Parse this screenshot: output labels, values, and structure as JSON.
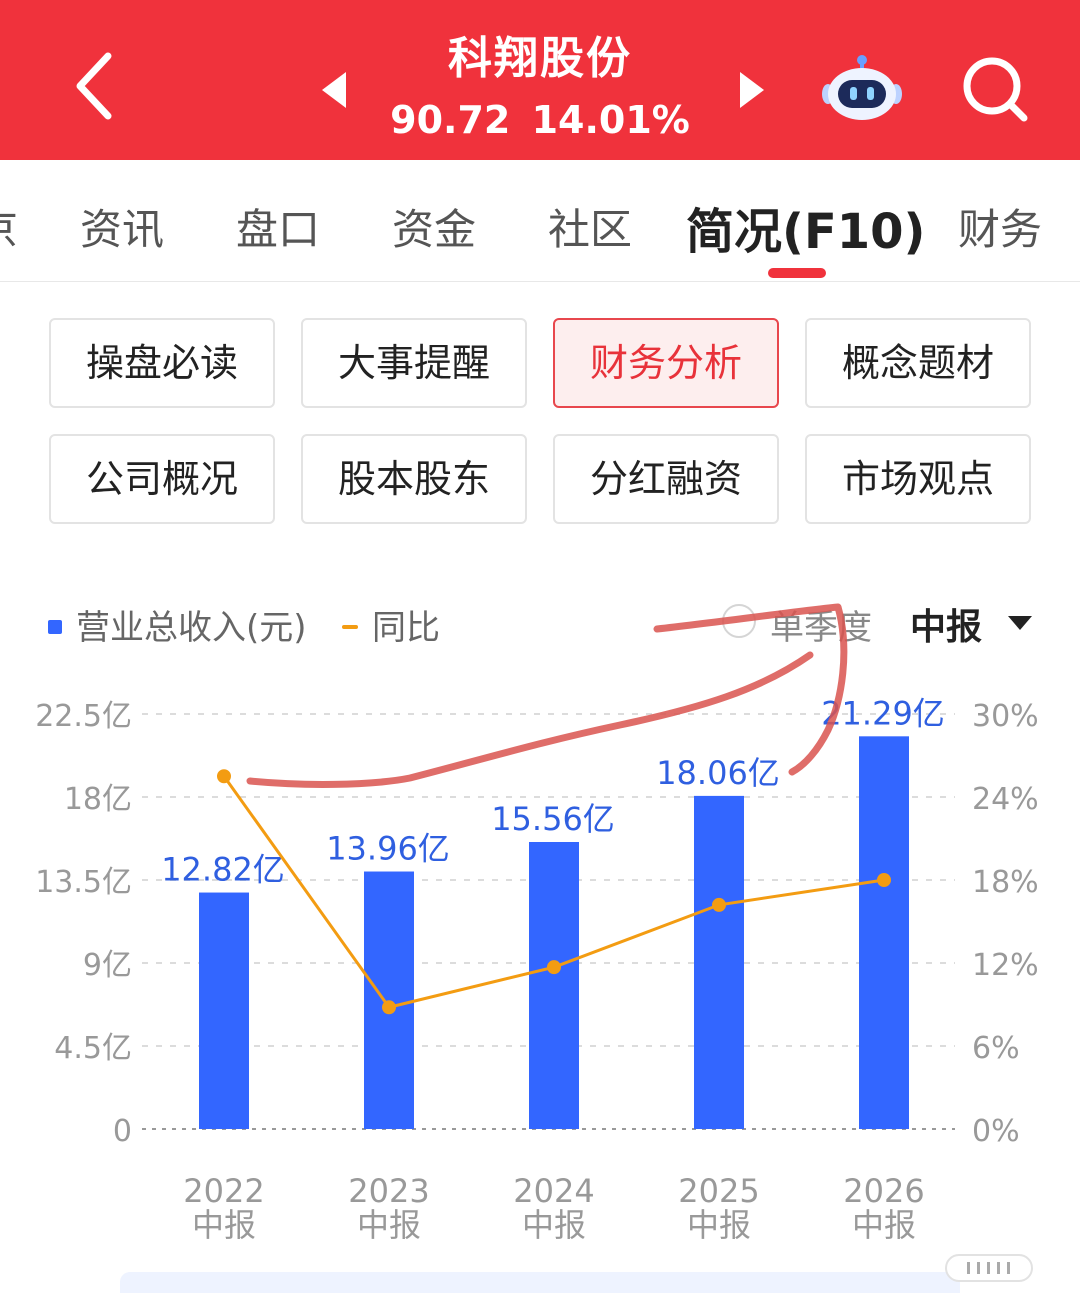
{
  "header": {
    "title": "科翔股份",
    "price": "90.72",
    "change_pct": "14.01%",
    "colors": {
      "brand": "#f0323c"
    }
  },
  "tabs": [
    {
      "label": "京",
      "active": false
    },
    {
      "label": "资讯",
      "active": false
    },
    {
      "label": "盘口",
      "active": false
    },
    {
      "label": "资金",
      "active": false
    },
    {
      "label": "社区",
      "active": false
    },
    {
      "label": "简况(F10)",
      "active": true
    },
    {
      "label": "财务",
      "active": false
    }
  ],
  "sub_buttons": [
    {
      "label": "操盘必读",
      "active": false
    },
    {
      "label": "大事提醒",
      "active": false
    },
    {
      "label": "财务分析",
      "active": true
    },
    {
      "label": "概念题材",
      "active": false
    },
    {
      "label": "公司概况",
      "active": false
    },
    {
      "label": "股本股东",
      "active": false
    },
    {
      "label": "分红融资",
      "active": false
    },
    {
      "label": "市场观点",
      "active": false
    }
  ],
  "legend": {
    "bar_label": "营业总收入(元)",
    "line_label": "同比"
  },
  "controls": {
    "single_quarter": "单季度",
    "period": "中报"
  },
  "chart_data": {
    "type": "bar",
    "categories": [
      "2022\n中报",
      "2023\n中报",
      "2024\n中报",
      "2025\n中报",
      "2026\n中报"
    ],
    "category_years": [
      "2022",
      "2023",
      "2024",
      "2025",
      "2026"
    ],
    "category_periods": [
      "中报",
      "中报",
      "中报",
      "中报",
      "中报"
    ],
    "series": [
      {
        "name": "营业总收入(元)",
        "type": "bar",
        "values": [
          12.82,
          13.96,
          15.56,
          18.06,
          21.29
        ],
        "labels": [
          "12.82亿",
          "13.96亿",
          "15.56亿",
          "18.06亿",
          "21.29亿"
        ],
        "color": "#3366ff",
        "axis": "left"
      },
      {
        "name": "同比",
        "type": "line",
        "values": [
          25.5,
          8.8,
          11.7,
          16.2,
          18.0
        ],
        "color": "#f39c12",
        "axis": "right"
      }
    ],
    "y_left": {
      "min": 0,
      "max": 22.5,
      "ticks": [
        "0",
        "4.5亿",
        "9亿",
        "13.5亿",
        "18亿",
        "22.5亿"
      ],
      "tick_values": [
        0,
        4.5,
        9,
        13.5,
        18,
        22.5
      ]
    },
    "y_right": {
      "min": 0,
      "max": 30,
      "ticks": [
        "0%",
        "6%",
        "12%",
        "18%",
        "24%",
        "30%"
      ],
      "tick_values": [
        0,
        6,
        12,
        18,
        24,
        30
      ]
    },
    "grid": "dashed"
  }
}
